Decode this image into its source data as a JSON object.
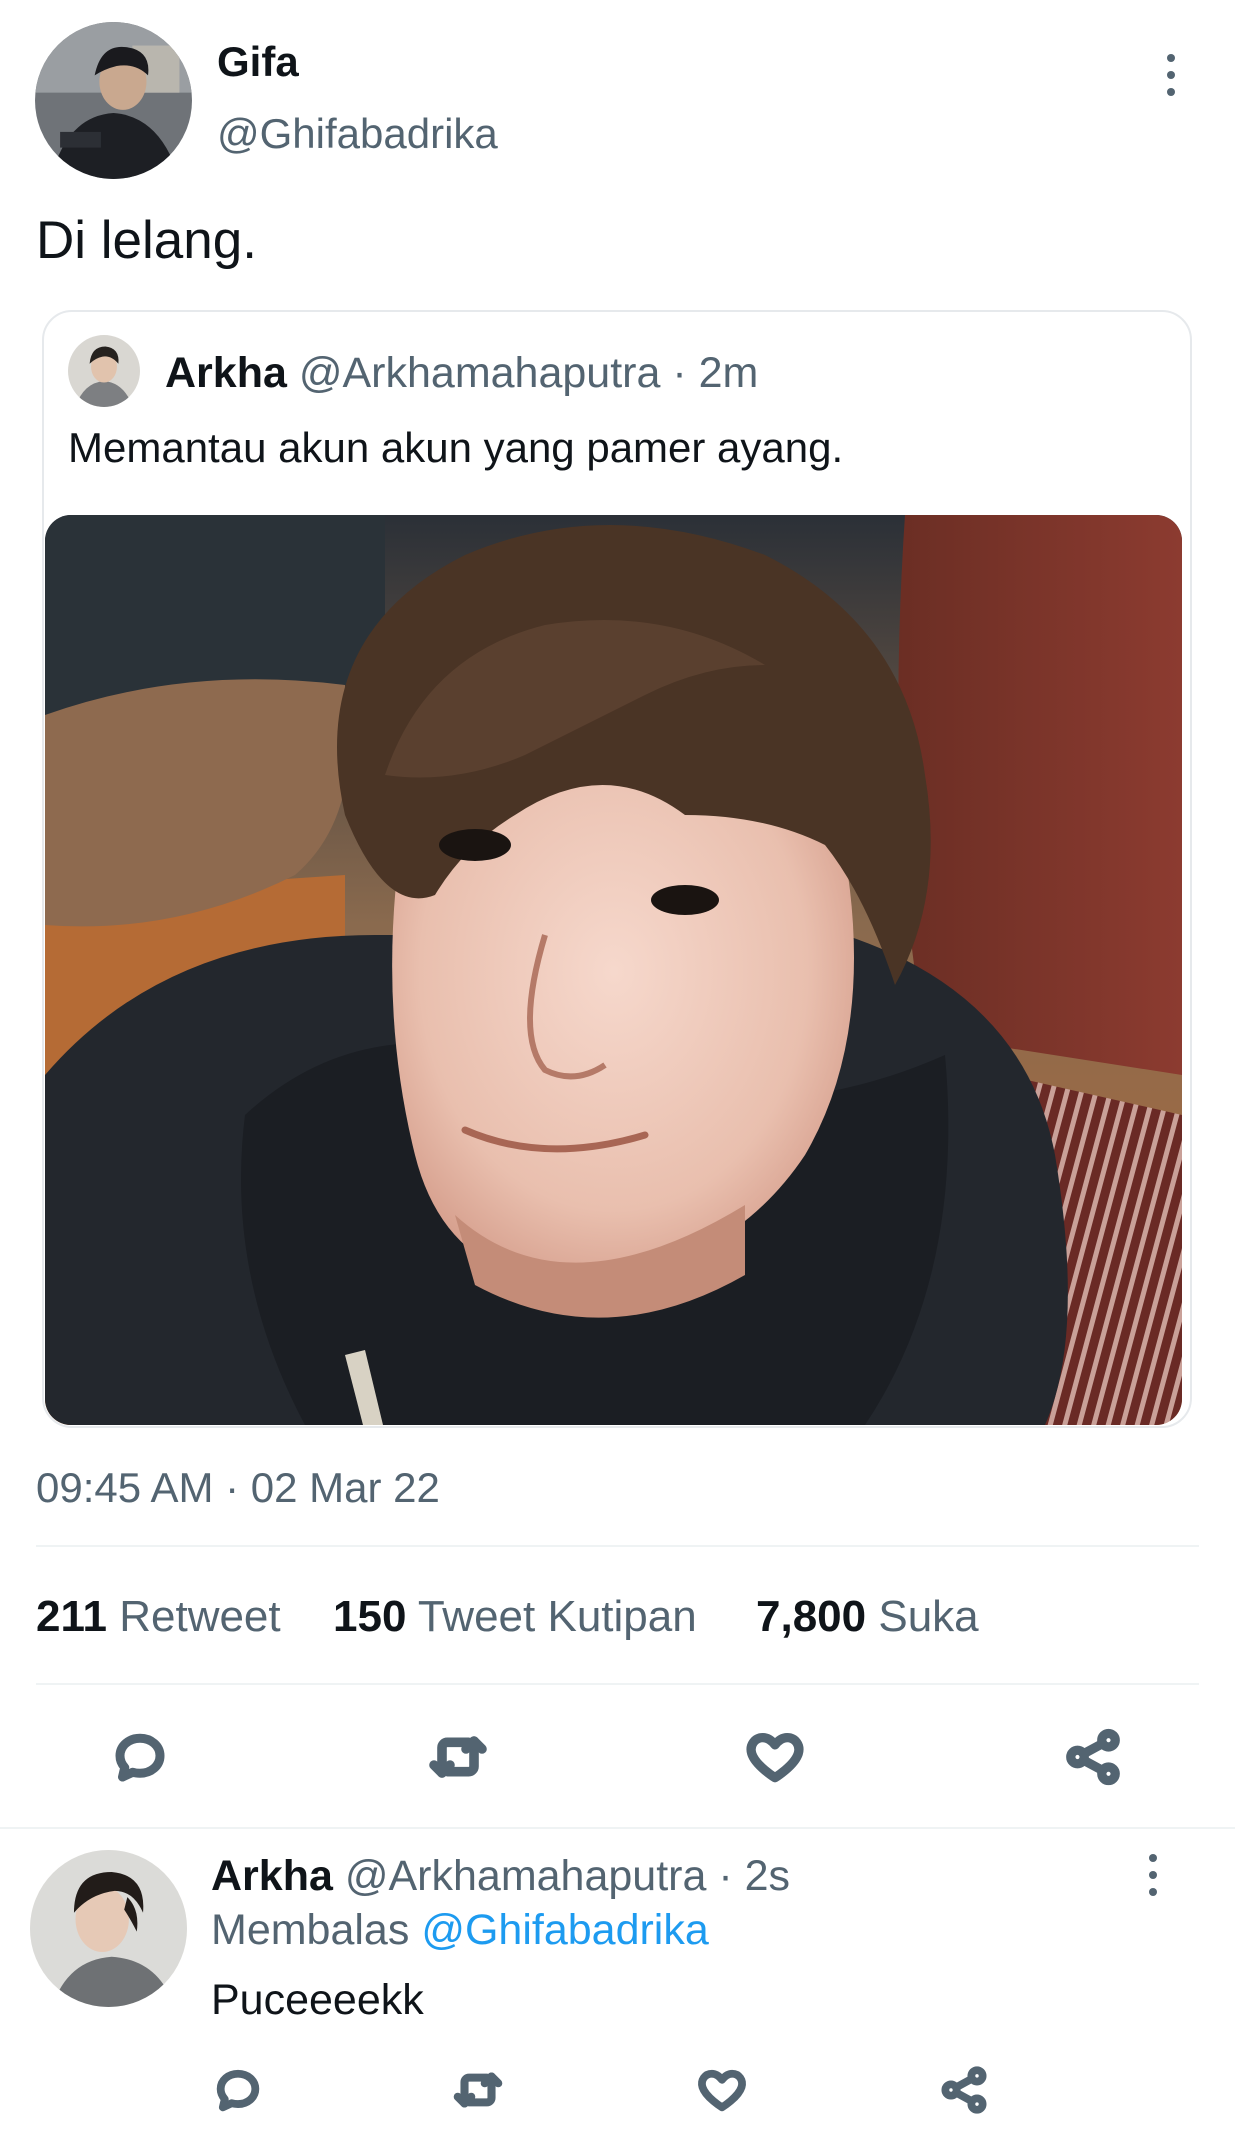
{
  "tweet": {
    "author_name": "Gifa",
    "author_handle": "@Ghifabadrika",
    "text": "Di lelang.",
    "timestamp": "09:45 AM · 02 Mar 22",
    "menu_icon": "more-vertical-icon"
  },
  "quoted": {
    "author_name": "Arkha",
    "author_handle": "@Arkhamahaputra",
    "separator": "·",
    "time": "2m",
    "text": "Memantau akun akun yang pamer ayang."
  },
  "stats": {
    "retweets": {
      "count": "211",
      "label": "Retweet"
    },
    "quotes": {
      "count": "150",
      "label": "Tweet Kutipan"
    },
    "likes": {
      "count": "7,800",
      "label": "Suka"
    }
  },
  "actions": [
    {
      "name": "reply",
      "icon": "reply-icon"
    },
    {
      "name": "retweet",
      "icon": "retweet-icon"
    },
    {
      "name": "like",
      "icon": "heart-icon"
    },
    {
      "name": "share",
      "icon": "share-icon"
    }
  ],
  "reply": {
    "author_name": "Arkha",
    "author_handle": "@Arkhamahaputra",
    "separator": "·",
    "time": "2s",
    "replying_prefix": "Membalas",
    "replying_to": "@Ghifabadrika",
    "text": "Puceeeekk"
  },
  "colors": {
    "link": "#1d9bf0",
    "secondary_text": "#536471",
    "divider": "#eff3f4"
  }
}
